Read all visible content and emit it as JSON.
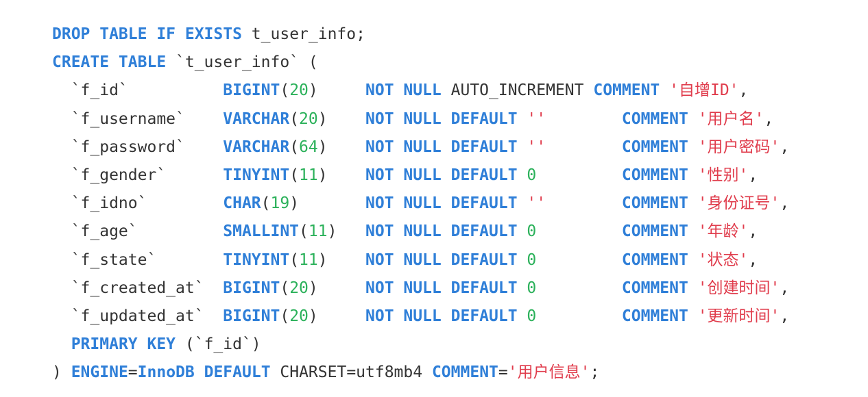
{
  "colors": {
    "keyword": "#2f7fd8",
    "number": "#2bb15a",
    "string": "#e03c4c",
    "plain": "#333333",
    "background": "#ffffff"
  },
  "lines": [
    [
      [
        "kw",
        "DROP TABLE IF EXISTS"
      ],
      [
        "p",
        " t_user_info;"
      ]
    ],
    [
      [
        "kw",
        "CREATE TABLE"
      ],
      [
        "p",
        " `t_user_info` ("
      ]
    ],
    [
      [
        "p",
        "  `f_id`          "
      ],
      [
        "kw",
        "BIGINT"
      ],
      [
        "p",
        "("
      ],
      [
        "num",
        "20"
      ],
      [
        "p",
        ")     "
      ],
      [
        "kw",
        "NOT NULL"
      ],
      [
        "p",
        " AUTO_INCREMENT "
      ],
      [
        "kw",
        "COMMENT"
      ],
      [
        "p",
        " "
      ],
      [
        "str",
        "'自增ID'"
      ],
      [
        "p",
        ","
      ]
    ],
    [
      [
        "p",
        "  `f_username`    "
      ],
      [
        "kw",
        "VARCHAR"
      ],
      [
        "p",
        "("
      ],
      [
        "num",
        "20"
      ],
      [
        "p",
        ")    "
      ],
      [
        "kw",
        "NOT NULL DEFAULT"
      ],
      [
        "p",
        " "
      ],
      [
        "str",
        "''"
      ],
      [
        "p",
        "        "
      ],
      [
        "kw",
        "COMMENT"
      ],
      [
        "p",
        " "
      ],
      [
        "str",
        "'用户名'"
      ],
      [
        "p",
        ","
      ]
    ],
    [
      [
        "p",
        "  `f_password`    "
      ],
      [
        "kw",
        "VARCHAR"
      ],
      [
        "p",
        "("
      ],
      [
        "num",
        "64"
      ],
      [
        "p",
        ")    "
      ],
      [
        "kw",
        "NOT NULL DEFAULT"
      ],
      [
        "p",
        " "
      ],
      [
        "str",
        "''"
      ],
      [
        "p",
        "        "
      ],
      [
        "kw",
        "COMMENT"
      ],
      [
        "p",
        " "
      ],
      [
        "str",
        "'用户密码'"
      ],
      [
        "p",
        ","
      ]
    ],
    [
      [
        "p",
        "  `f_gender`      "
      ],
      [
        "kw",
        "TINYINT"
      ],
      [
        "p",
        "("
      ],
      [
        "num",
        "11"
      ],
      [
        "p",
        ")    "
      ],
      [
        "kw",
        "NOT NULL DEFAULT"
      ],
      [
        "p",
        " "
      ],
      [
        "num",
        "0"
      ],
      [
        "p",
        "         "
      ],
      [
        "kw",
        "COMMENT"
      ],
      [
        "p",
        " "
      ],
      [
        "str",
        "'性别'"
      ],
      [
        "p",
        ","
      ]
    ],
    [
      [
        "p",
        "  `f_idno`        "
      ],
      [
        "kw",
        "CHAR"
      ],
      [
        "p",
        "("
      ],
      [
        "num",
        "19"
      ],
      [
        "p",
        ")       "
      ],
      [
        "kw",
        "NOT NULL DEFAULT"
      ],
      [
        "p",
        " "
      ],
      [
        "str",
        "''"
      ],
      [
        "p",
        "        "
      ],
      [
        "kw",
        "COMMENT"
      ],
      [
        "p",
        " "
      ],
      [
        "str",
        "'身份证号'"
      ],
      [
        "p",
        ","
      ]
    ],
    [
      [
        "p",
        "  `f_age`         "
      ],
      [
        "kw",
        "SMALLINT"
      ],
      [
        "p",
        "("
      ],
      [
        "num",
        "11"
      ],
      [
        "p",
        ")   "
      ],
      [
        "kw",
        "NOT NULL DEFAULT"
      ],
      [
        "p",
        " "
      ],
      [
        "num",
        "0"
      ],
      [
        "p",
        "         "
      ],
      [
        "kw",
        "COMMENT"
      ],
      [
        "p",
        " "
      ],
      [
        "str",
        "'年龄'"
      ],
      [
        "p",
        ","
      ]
    ],
    [
      [
        "p",
        "  `f_state`       "
      ],
      [
        "kw",
        "TINYINT"
      ],
      [
        "p",
        "("
      ],
      [
        "num",
        "11"
      ],
      [
        "p",
        ")    "
      ],
      [
        "kw",
        "NOT NULL DEFAULT"
      ],
      [
        "p",
        " "
      ],
      [
        "num",
        "0"
      ],
      [
        "p",
        "         "
      ],
      [
        "kw",
        "COMMENT"
      ],
      [
        "p",
        " "
      ],
      [
        "str",
        "'状态'"
      ],
      [
        "p",
        ","
      ]
    ],
    [
      [
        "p",
        "  `f_created_at`  "
      ],
      [
        "kw",
        "BIGINT"
      ],
      [
        "p",
        "("
      ],
      [
        "num",
        "20"
      ],
      [
        "p",
        ")     "
      ],
      [
        "kw",
        "NOT NULL DEFAULT"
      ],
      [
        "p",
        " "
      ],
      [
        "num",
        "0"
      ],
      [
        "p",
        "         "
      ],
      [
        "kw",
        "COMMENT"
      ],
      [
        "p",
        " "
      ],
      [
        "str",
        "'创建时间'"
      ],
      [
        "p",
        ","
      ]
    ],
    [
      [
        "p",
        "  `f_updated_at`  "
      ],
      [
        "kw",
        "BIGINT"
      ],
      [
        "p",
        "("
      ],
      [
        "num",
        "20"
      ],
      [
        "p",
        ")     "
      ],
      [
        "kw",
        "NOT NULL DEFAULT"
      ],
      [
        "p",
        " "
      ],
      [
        "num",
        "0"
      ],
      [
        "p",
        "         "
      ],
      [
        "kw",
        "COMMENT"
      ],
      [
        "p",
        " "
      ],
      [
        "str",
        "'更新时间'"
      ],
      [
        "p",
        ","
      ]
    ],
    [
      [
        "p",
        "  "
      ],
      [
        "kw",
        "PRIMARY KEY"
      ],
      [
        "p",
        " (`f_id`)"
      ]
    ],
    [
      [
        "p",
        ") "
      ],
      [
        "kw",
        "ENGINE"
      ],
      [
        "p",
        "="
      ],
      [
        "kw",
        "InnoDB"
      ],
      [
        "p",
        " "
      ],
      [
        "kw",
        "DEFAULT"
      ],
      [
        "p",
        " CHARSET=utf8mb4 "
      ],
      [
        "kw",
        "COMMENT"
      ],
      [
        "p",
        "="
      ],
      [
        "str",
        "'用户信息'"
      ],
      [
        "p",
        ";"
      ]
    ]
  ]
}
